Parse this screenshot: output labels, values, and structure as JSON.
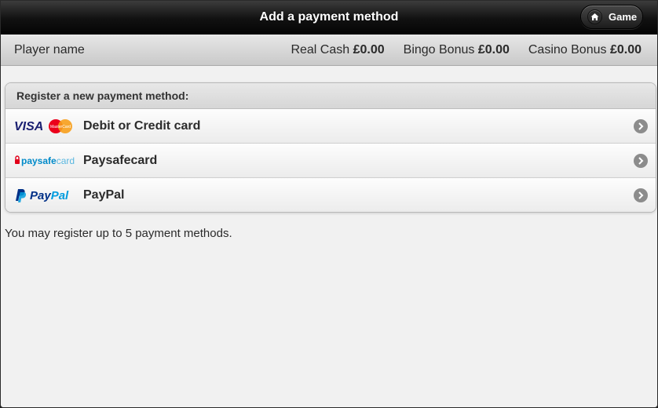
{
  "header": {
    "title": "Add a payment method",
    "game_button": "Game",
    "home_icon": "home-icon"
  },
  "infobar": {
    "player_name": "Player name",
    "balances": [
      {
        "label": "Real Cash",
        "value": "£0.00"
      },
      {
        "label": "Bingo Bonus",
        "value": "£0.00"
      },
      {
        "label": "Casino Bonus",
        "value": "£0.00"
      }
    ]
  },
  "panel": {
    "header": "Register a new payment method:",
    "methods": [
      {
        "label": "Debit or Credit card",
        "logo": "visa-mastercard-logo"
      },
      {
        "label": "Paysafecard",
        "logo": "paysafecard-logo"
      },
      {
        "label": "PayPal",
        "logo": "paypal-logo"
      }
    ]
  },
  "note": "You may register up to 5 payment methods.",
  "logo_text": {
    "visa": "VISA",
    "mastercard": "MasterCard",
    "paysafe_a": "paysafe",
    "paysafe_b": "card",
    "paypal_a": "Pay",
    "paypal_b": "Pal"
  },
  "colors": {
    "topbar": "#111111",
    "visa_blue": "#1a1f71",
    "mastercard_red": "#eb001b",
    "mastercard_orange": "#f79e1b",
    "paysafe_blue": "#008ac9",
    "paysafe_red": "#e2001a",
    "paypal_dark": "#003087",
    "paypal_light": "#009cde"
  }
}
